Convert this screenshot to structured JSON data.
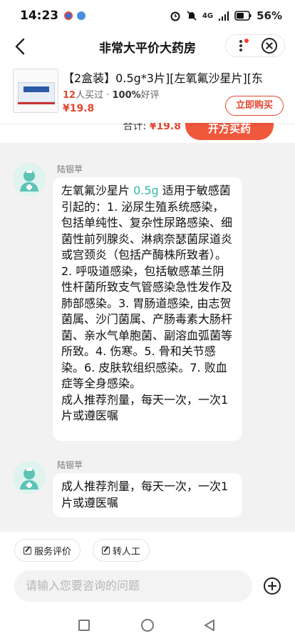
{
  "status": {
    "time": "14:23",
    "network": "4G",
    "battery": "56%"
  },
  "nav": {
    "title": "非常大平价大药房"
  },
  "product": {
    "title": "【2盒装】0.5g*3片][左氧氟沙星片][东",
    "sold_count": "12",
    "sold_suffix": "人买过 · ",
    "good_rate": "100%",
    "good_suffix": "好评",
    "price": "¥19.8",
    "buy_label": "立即购买"
  },
  "prev_card": {
    "total_label": "合计: ",
    "total_value": "¥19.8",
    "action_label": "开方买药"
  },
  "messages": [
    {
      "sender": "陆银苹",
      "highlight_prefix": "左氧氟沙星片 ",
      "highlight": "0.5g",
      "text": " 适用于敏感菌引起的：1. 泌尿生殖系统感染，包括单纯性、复杂性尿路感染、细菌性前列腺炎、淋病奈瑟菌尿道炎或宫颈炎（包括产酶株所致者）。2. 呼吸道感染，包括敏感革兰阴性杆菌所致支气管感染急性发作及肺部感染。3. 胃肠道感染, 由志贺菌属、沙门菌属、产肠毒素大肠杆菌、亲水气单胞菌、副溶血弧菌等所致。4. 伤寒。5. 骨和关节感染。6. 皮肤软组织感染。7. 败血症等全身感染。",
      "text2": "成人推荐剂量，每天一次，一次1片或遵医嘱"
    },
    {
      "sender": "陆银苹",
      "text": "成人推荐剂量，每天一次，一次1片或遵医嘱"
    }
  ],
  "bottom": {
    "chip_review": "服务评价",
    "chip_transfer": "转人工",
    "input_placeholder": "请输入您要咨询的问题"
  },
  "colors": {
    "accent": "#e5462f",
    "teal": "#35b8a9"
  }
}
